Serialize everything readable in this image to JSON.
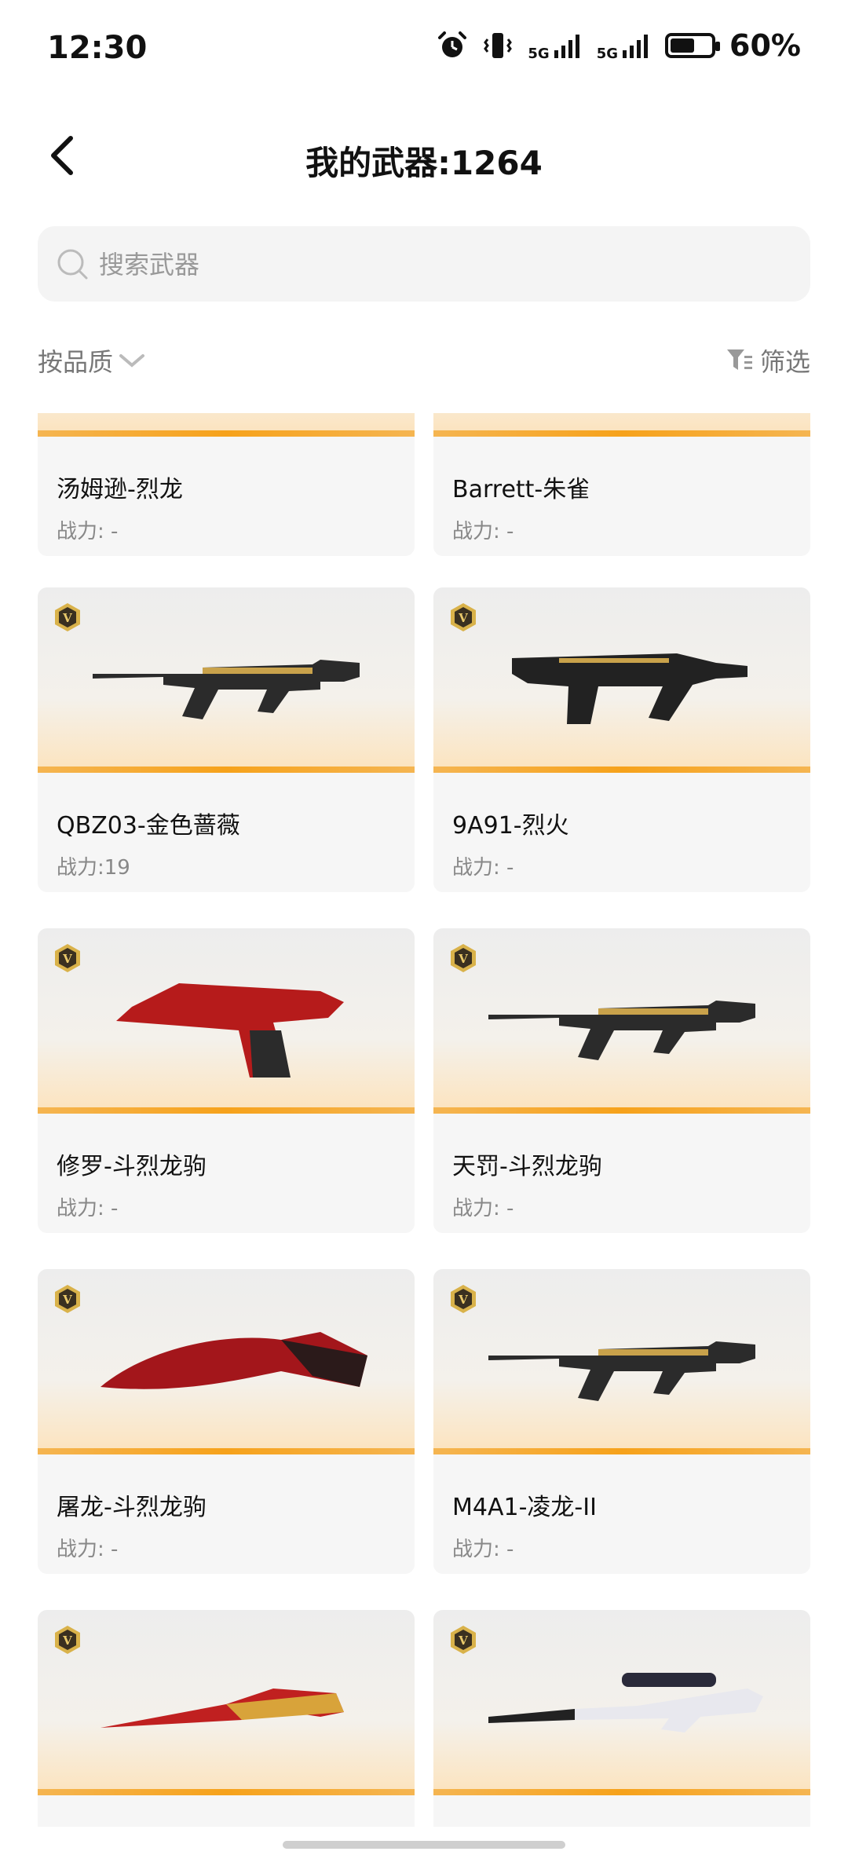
{
  "status": {
    "time": "12:30",
    "battery": "60%",
    "battery_level": 0.6,
    "network1": "5G",
    "network2": "5G"
  },
  "header": {
    "title": "我的武器:1264"
  },
  "search": {
    "placeholder": "搜索武器"
  },
  "sort": {
    "label": "按品质"
  },
  "filter": {
    "label": "筛选"
  },
  "colors": {
    "accent": "#f6a21b",
    "card_bg": "#f6f6f6",
    "badge_gold": "#d9b24a"
  },
  "weapons": [
    {
      "name": "汤姆逊-烈龙",
      "power": "战力: -",
      "weapon_icon": "rifle-icon"
    },
    {
      "name": "Barrett-朱雀",
      "power": "战力: -",
      "weapon_icon": "sniper-icon"
    },
    {
      "name": "QBZ03-金色蔷薇",
      "power": "战力:19",
      "weapon_icon": "rifle-icon"
    },
    {
      "name": "9A91-烈火",
      "power": "战力: -",
      "weapon_icon": "smg-icon"
    },
    {
      "name": "修罗-斗烈龙驹",
      "power": "战力: -",
      "weapon_icon": "pistol-icon"
    },
    {
      "name": "天罚-斗烈龙驹",
      "power": "战力: -",
      "weapon_icon": "rifle-icon"
    },
    {
      "name": "屠龙-斗烈龙驹",
      "power": "战力: -",
      "weapon_icon": "knife-icon"
    },
    {
      "name": "M4A1-凌龙-II",
      "power": "战力: -",
      "weapon_icon": "rifle-icon"
    },
    {
      "name": "",
      "power": "",
      "weapon_icon": "blade-icon"
    },
    {
      "name": "",
      "power": "",
      "weapon_icon": "sniper-icon"
    }
  ]
}
